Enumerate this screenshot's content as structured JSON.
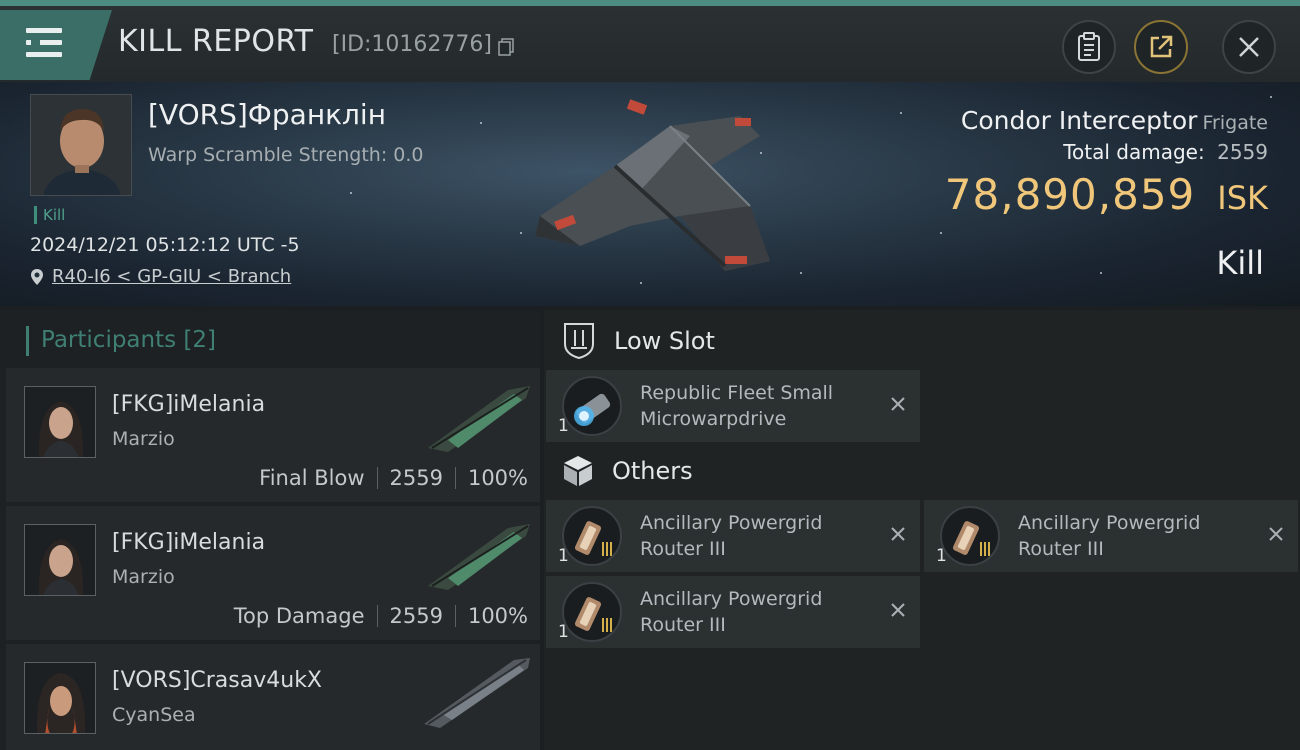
{
  "header": {
    "title": "KILL REPORT",
    "report_id": "[ID:10162776]"
  },
  "victim": {
    "name": "[VORS]Франклін",
    "warp_scramble": "Warp Scramble Strength: 0.0",
    "tag": "Kill",
    "datetime": "2024/12/21 05:12:12 UTC -5",
    "location": "R40-I6 < GP-GIU < Branch"
  },
  "ship": {
    "name": "Condor Interceptor",
    "class": "Frigate",
    "total_damage_label": "Total damage:",
    "total_damage": "2559",
    "isk_value": "78,890,859",
    "isk_unit": "ISK",
    "result": "Kill"
  },
  "participants": {
    "heading": "Participants [2]",
    "list": [
      {
        "name": "[FKG]iMelania",
        "ship": "Marzio",
        "role": "Final Blow",
        "damage": "2559",
        "percent": "100%"
      },
      {
        "name": "[FKG]iMelania",
        "ship": "Marzio",
        "role": "Top Damage",
        "damage": "2559",
        "percent": "100%"
      },
      {
        "name": "[VORS]Crasav4ukX",
        "ship": "CyanSea",
        "role": "",
        "damage": "",
        "percent": ""
      }
    ]
  },
  "fittings": {
    "low_slot": {
      "label": "Low Slot",
      "items": [
        {
          "name": "Republic Fleet Small Microwarpdrive",
          "qty": "1"
        }
      ]
    },
    "others": {
      "label": "Others",
      "items": [
        {
          "name": "Ancillary Powergrid Router III",
          "qty": "1"
        },
        {
          "name": "Ancillary Powergrid Router III",
          "qty": "1"
        },
        {
          "name": "Ancillary Powergrid Router III",
          "qty": "1"
        }
      ]
    }
  },
  "colors": {
    "accent": "#3f7f74",
    "isk_gold": "#f0c77a",
    "menu_tab": "#3a6e66"
  },
  "icons": [
    "menu-icon",
    "copy-icon",
    "clipboard-icon",
    "share-icon",
    "close-icon",
    "location-pin-icon",
    "low-slot-icon",
    "cube-icon",
    "remove-icon"
  ]
}
